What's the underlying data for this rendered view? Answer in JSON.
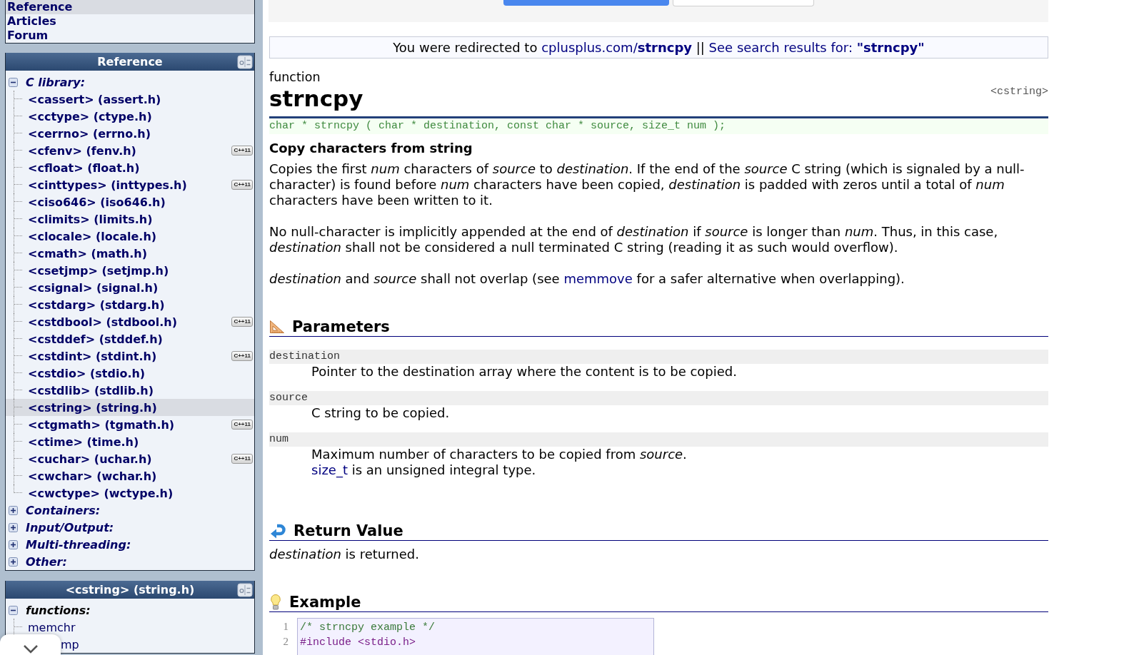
{
  "sidebar": {
    "nav": [
      {
        "label": "Reference",
        "selected": true
      },
      {
        "label": "Articles",
        "selected": false
      },
      {
        "label": "Forum",
        "selected": false
      }
    ],
    "panels": [
      {
        "kind": "library",
        "title": "Reference",
        "groups": [
          {
            "label": "C library:",
            "expanded": true,
            "children": [
              {
                "label": "<cassert> (assert.h)",
                "selected": false
              },
              {
                "label": "<cctype> (ctype.h)",
                "selected": false
              },
              {
                "label": "<cerrno> (errno.h)",
                "selected": false
              },
              {
                "label": "<cfenv> (fenv.h)",
                "selected": false,
                "badge": "C++11"
              },
              {
                "label": "<cfloat> (float.h)",
                "selected": false
              },
              {
                "label": "<cinttypes> (inttypes.h)",
                "selected": false,
                "badge": "C++11"
              },
              {
                "label": "<ciso646> (iso646.h)",
                "selected": false
              },
              {
                "label": "<climits> (limits.h)",
                "selected": false
              },
              {
                "label": "<clocale> (locale.h)",
                "selected": false
              },
              {
                "label": "<cmath> (math.h)",
                "selected": false
              },
              {
                "label": "<csetjmp> (setjmp.h)",
                "selected": false
              },
              {
                "label": "<csignal> (signal.h)",
                "selected": false
              },
              {
                "label": "<cstdarg> (stdarg.h)",
                "selected": false
              },
              {
                "label": "<cstdbool> (stdbool.h)",
                "selected": false,
                "badge": "C++11"
              },
              {
                "label": "<cstddef> (stddef.h)",
                "selected": false
              },
              {
                "label": "<cstdint> (stdint.h)",
                "selected": false,
                "badge": "C++11"
              },
              {
                "label": "<cstdio> (stdio.h)",
                "selected": false
              },
              {
                "label": "<cstdlib> (stdlib.h)",
                "selected": false
              },
              {
                "label": "<cstring> (string.h)",
                "selected": true
              },
              {
                "label": "<ctgmath> (tgmath.h)",
                "selected": false,
                "badge": "C++11"
              },
              {
                "label": "<ctime> (time.h)",
                "selected": false
              },
              {
                "label": "<cuchar> (uchar.h)",
                "selected": false,
                "badge": "C++11"
              },
              {
                "label": "<cwchar> (wchar.h)",
                "selected": false
              },
              {
                "label": "<cwctype> (wctype.h)",
                "selected": false
              }
            ]
          },
          {
            "label": "Containers:",
            "expanded": false
          },
          {
            "label": "Input/Output:",
            "expanded": false
          },
          {
            "label": "Multi-threading:",
            "expanded": false
          },
          {
            "label": "Other:",
            "expanded": false
          }
        ]
      },
      {
        "kind": "header",
        "title": "<cstring> (string.h)",
        "groups": [
          {
            "label": "functions:",
            "expanded": true,
            "children": [
              {
                "label": "memchr",
                "selected": false,
                "covered": false
              },
              {
                "label": "mp",
                "selected": false,
                "covered": true
              }
            ]
          }
        ]
      }
    ]
  },
  "redirect": {
    "parts": [
      {
        "kind": "text",
        "text": "You were redirected to "
      },
      {
        "kind": "link",
        "text": "cplusplus.com/**strncpy**"
      },
      {
        "kind": "text",
        "text": " || "
      },
      {
        "kind": "link",
        "text": "See search results for: **\"strncpy\"**"
      }
    ]
  },
  "article": {
    "kind_label": "function",
    "title": "strncpy",
    "header": "<cstring>",
    "prototype": "char * strncpy ( char * destination, const char * source, size_t num );",
    "summary": "Copy characters from string",
    "paragraphs": [
      {
        "parts": [
          {
            "kind": "text",
            "text": "Copies the first *num* characters of *source* to *destination*. If the end of the *source* C string (which is signaled by a null-character) is found before *num* characters have been copied, *destination* is padded with zeros until a total of *num* characters have been written to it."
          }
        ]
      },
      {
        "parts": [
          {
            "kind": "text",
            "text": "No null-character is implicitly appended at the end of *destination* if *source* is longer than *num*. Thus, in this case, *destination* shall not be considered a null terminated C string (reading it as such would overflow)."
          }
        ]
      },
      {
        "parts": [
          {
            "kind": "text",
            "text": "*destination* and *source* shall not overlap (see "
          },
          {
            "kind": "link",
            "text": "memmove"
          },
          {
            "kind": "text",
            "text": " for a safer alternative when overlapping)."
          }
        ]
      }
    ],
    "sections": [
      {
        "kind": "parameters",
        "title": "Parameters",
        "params": [
          {
            "name": "destination",
            "description": [
              {
                "parts": [
                  {
                    "kind": "text",
                    "text": "Pointer to the destination array where the content is to be copied."
                  }
                ]
              }
            ]
          },
          {
            "name": "source",
            "description": [
              {
                "parts": [
                  {
                    "kind": "text",
                    "text": "C string to be copied."
                  }
                ]
              }
            ]
          },
          {
            "name": "num",
            "description": [
              {
                "parts": [
                  {
                    "kind": "text",
                    "text": "Maximum number of characters to be copied from *source*."
                  }
                ]
              },
              {
                "parts": [
                  {
                    "kind": "link",
                    "text": "size_t"
                  },
                  {
                    "kind": "text",
                    "text": " is an unsigned integral type."
                  }
                ]
              }
            ]
          }
        ]
      },
      {
        "kind": "return",
        "title": "Return Value",
        "paragraphs": [
          {
            "parts": [
              {
                "kind": "text",
                "text": "*destination* is returned."
              }
            ]
          }
        ]
      },
      {
        "kind": "example",
        "title": "Example",
        "code": [
          {
            "number": "1",
            "kind": "comment",
            "text": "/* strncpy example */"
          },
          {
            "number": "2",
            "kind": "preprocessor",
            "text": "#include <stdio.h>"
          }
        ]
      }
    ]
  }
}
